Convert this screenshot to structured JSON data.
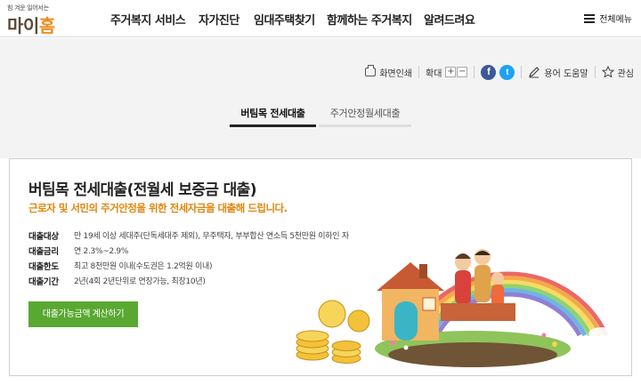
{
  "logo": {
    "tagline": "힘 겨운 일어서는",
    "name_part1": "마이",
    "name_part2": "홈"
  },
  "nav": {
    "items": [
      "주거복지 서비스",
      "자가진단",
      "임대주택찾기",
      "함께하는 주거복지",
      "알려드려요"
    ],
    "all_menu": "전체메뉴"
  },
  "tools": {
    "print": "화면인쇄",
    "zoom": "확대",
    "zoom_in": "+",
    "zoom_out": "−",
    "facebook": "f",
    "twitter": "t",
    "glossary": "용어 도움말",
    "favorite": "관심"
  },
  "tabs": [
    "버팀목 전세대출",
    "주거안정월세대출"
  ],
  "content": {
    "title": "버팀목 전세대출(전월세 보증금 대출)",
    "subtitle": "근로자 및 서민의 주거안정을 위한 전세자금을 대출해 드립니다.",
    "rows": [
      {
        "label": "대출대상",
        "value": "만 19세 이상 세대주(단독세대주 제외), 무주택자, 부부합산 연소득 5천만원 이하인 자"
      },
      {
        "label": "대출금리",
        "value": "연 2.3%~2.9%"
      },
      {
        "label": "대출한도",
        "value": "최고 8천만원 이내(수도권은 1.2억원 이내)"
      },
      {
        "label": "대출기간",
        "value": "2년(4회 2년단위로 연장가능, 최장10년)"
      }
    ],
    "cta": "대출가능금액 계산하기"
  },
  "colors": {
    "accent_orange": "#e2860c",
    "button_green": "#59a832",
    "facebook": "#3b5998",
    "twitter": "#1da1f2"
  }
}
